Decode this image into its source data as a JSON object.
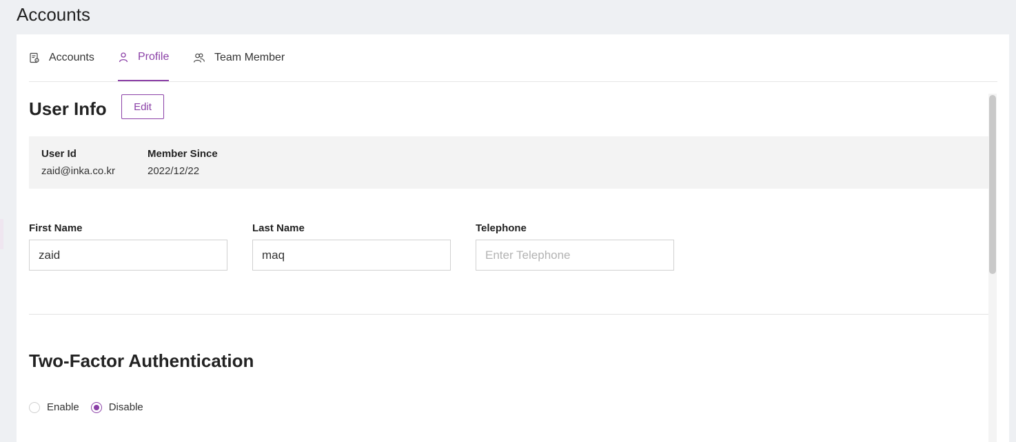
{
  "page": {
    "title": "Accounts"
  },
  "tabs": [
    {
      "label": "Accounts",
      "icon": "document-settings-icon",
      "active": false
    },
    {
      "label": "Profile",
      "icon": "person-icon",
      "active": true
    },
    {
      "label": "Team Member",
      "icon": "people-icon",
      "active": false
    }
  ],
  "user_info": {
    "title": "User Info",
    "edit_label": "Edit",
    "user_id_label": "User Id",
    "user_id_value": "zaid@inka.co.kr",
    "member_since_label": "Member Since",
    "member_since_value": "2022/12/22"
  },
  "form": {
    "first_name_label": "First Name",
    "first_name_value": "zaid",
    "last_name_label": "Last Name",
    "last_name_value": "maq",
    "telephone_label": "Telephone",
    "telephone_value": "",
    "telephone_placeholder": "Enter Telephone"
  },
  "two_factor": {
    "title": "Two-Factor Authentication",
    "enable_label": "Enable",
    "disable_label": "Disable",
    "selected": "Disable"
  },
  "colors": {
    "accent": "#8a3fa6",
    "background": "#eef0f3",
    "info_box": "#f3f3f3"
  }
}
